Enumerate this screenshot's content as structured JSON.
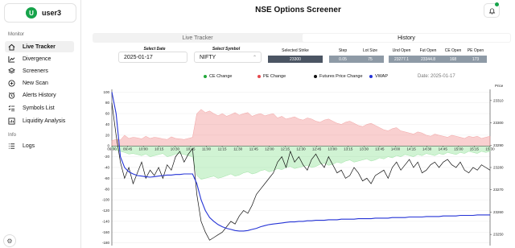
{
  "user": {
    "avatar_letter": "U",
    "name": "user3"
  },
  "sidebar": {
    "section_monitor": "Monitor",
    "section_info": "Info",
    "items": [
      {
        "label": "Live Tracker",
        "icon": "home-icon",
        "active": true
      },
      {
        "label": "Divergence",
        "icon": "trend-icon",
        "active": false
      },
      {
        "label": "Screeners",
        "icon": "layers-icon",
        "active": false
      },
      {
        "label": "New Scan",
        "icon": "plus-circle-icon",
        "active": false
      },
      {
        "label": "Alerts History",
        "icon": "alarm-icon",
        "active": false
      },
      {
        "label": "Symbols List",
        "icon": "list-check-icon",
        "active": false
      },
      {
        "label": "Liquidity Analysis",
        "icon": "chart-icon",
        "active": false
      }
    ],
    "info_items": [
      {
        "label": "Logs",
        "icon": "list-icon"
      }
    ]
  },
  "header": {
    "title": "NSE Options Screener"
  },
  "tabs": [
    {
      "label": "Live Tracker",
      "active": false
    },
    {
      "label": "History",
      "active": true
    }
  ],
  "filters": {
    "date_label": "Select Date",
    "date_value": "2025-01-17",
    "symbol_label": "Select Symbol",
    "symbol_value": "NIFTY"
  },
  "stats": {
    "selected_strike_label": "Selected Strike",
    "selected_strike_value": "23300",
    "step_label": "Step",
    "step_value": "0.05",
    "lot_size_label": "Lot Size",
    "lot_size_value": "75",
    "und_open_label": "Und Open",
    "und_open_value": "23277.1",
    "fut_open_label": "Fut Open",
    "fut_open_value": "23344.8",
    "ce_open_label": "CE Open",
    "ce_open_value": "168",
    "pe_open_label": "PE Open",
    "pe_open_value": "173"
  },
  "legend": {
    "items": [
      {
        "label": "CE Change",
        "color": "#22a83a"
      },
      {
        "label": "PE Change",
        "color": "#e5484d"
      },
      {
        "label": "Futures Price Change",
        "color": "#111111"
      },
      {
        "label": "VWAP",
        "color": "#2433d6"
      }
    ],
    "date_note": "Date: 2025-01-17"
  },
  "chart_data": {
    "type": "area",
    "x_ticks": [
      "09:30",
      "09:45",
      "10:00",
      "10:15",
      "10:30",
      "10:45",
      "11:00",
      "11:15",
      "11:30",
      "11:45",
      "12:00",
      "12:15",
      "12:30",
      "12:45",
      "13:00",
      "13:15",
      "13:30",
      "13:45",
      "14:00",
      "14:15",
      "14:30",
      "14:45",
      "15:00",
      "15:15",
      "15:30"
    ],
    "y_left_ticks": [
      100,
      80,
      60,
      40,
      20,
      0,
      -20,
      -40,
      -60,
      -80,
      -100,
      -120,
      -140,
      -160,
      -180
    ],
    "y_left_range": [
      -185,
      105
    ],
    "y_right_label": "Price",
    "y_right_ticks": [
      23310,
      23300,
      23290,
      23280,
      23270,
      23260,
      23250
    ],
    "y_right_range": [
      23245,
      23315
    ],
    "grid": true,
    "series": [
      {
        "name": "PE Change",
        "color": "#e5484d",
        "values": [
          10,
          12,
          11,
          20,
          14,
          16,
          15,
          13,
          18,
          14,
          16,
          15,
          13,
          12,
          17,
          14,
          13,
          12,
          14,
          16,
          60,
          68,
          62,
          65,
          60,
          56,
          60,
          55,
          58,
          62,
          57,
          60,
          62,
          55,
          58,
          60,
          56,
          58,
          60,
          52,
          55,
          50,
          52,
          54,
          50,
          48,
          52,
          50,
          46,
          44,
          48,
          50,
          46,
          42,
          40,
          44,
          46,
          42,
          38,
          36,
          40,
          42,
          38,
          34,
          30,
          28,
          32,
          34,
          28,
          26,
          24,
          22,
          26,
          24,
          20,
          18,
          22,
          20,
          18,
          16,
          20,
          18,
          16,
          14,
          18,
          16,
          18,
          14,
          16,
          18
        ]
      },
      {
        "name": "CE Change",
        "color": "#22a83a",
        "values": [
          -5,
          -8,
          -10,
          -12,
          -15,
          -14,
          -16,
          -18,
          -15,
          -20,
          -18,
          -16,
          -14,
          -20,
          -18,
          -15,
          -14,
          -16,
          -18,
          -20,
          -55,
          -62,
          -60,
          -58,
          -56,
          -60,
          -58,
          -55,
          -52,
          -56,
          -54,
          -50,
          -48,
          -52,
          -50,
          -46,
          -44,
          -48,
          -46,
          -42,
          -44,
          -40,
          -38,
          -42,
          -40,
          -38,
          -36,
          -40,
          -38,
          -34,
          -32,
          -36,
          -34,
          -30,
          -32,
          -28,
          -26,
          -30,
          -28,
          -26,
          -24,
          -28,
          -26,
          -22,
          -24,
          -20,
          -22,
          -18,
          -20,
          -16,
          -18,
          -20,
          -16,
          -18,
          -14,
          -16,
          -18,
          -14,
          -16,
          -12,
          -14,
          -16,
          -12,
          -14,
          -10,
          -12,
          -14,
          -10,
          -12,
          -10
        ]
      },
      {
        "name": "Futures Price Change",
        "color": "#111111",
        "values": [
          80,
          20,
          -30,
          -60,
          -40,
          -70,
          -50,
          -30,
          -60,
          -45,
          -55,
          -40,
          -60,
          -35,
          -45,
          -20,
          -10,
          -30,
          -15,
          -5,
          -90,
          -140,
          -160,
          -175,
          -170,
          -165,
          -160,
          -150,
          -140,
          -145,
          -130,
          -120,
          -125,
          -110,
          -90,
          -80,
          -70,
          -60,
          -50,
          -30,
          -20,
          -40,
          -10,
          -30,
          -20,
          -35,
          -45,
          -25,
          -15,
          -30,
          -40,
          -20,
          -35,
          -50,
          -45,
          -60,
          -55,
          -40,
          -50,
          -65,
          -60,
          -70,
          -55,
          -50,
          -45,
          -60,
          -40,
          -30,
          -45,
          -35,
          -25,
          -40,
          -30,
          -50,
          -45,
          -35,
          -30,
          -40,
          -30,
          -25,
          -35,
          -40,
          -30,
          -45,
          -50,
          -40,
          -45,
          -35,
          -40,
          -45
        ]
      },
      {
        "name": "VWAP",
        "color": "#2433d6",
        "values": [
          100,
          60,
          -20,
          -40,
          -48,
          -52,
          -55,
          -56,
          -57,
          -58,
          -57,
          -56,
          -55,
          -54,
          -54,
          -53,
          -53,
          -52,
          -52,
          -52,
          -70,
          -100,
          -120,
          -133,
          -140,
          -146,
          -150,
          -153,
          -155,
          -157,
          -158,
          -158,
          -157,
          -155,
          -153,
          -150,
          -148,
          -146,
          -145,
          -144,
          -143,
          -142,
          -141,
          -141,
          -140,
          -140,
          -139,
          -139,
          -138,
          -138,
          -138,
          -137,
          -137,
          -137,
          -136,
          -136,
          -136,
          -136,
          -135,
          -135,
          -135,
          -135,
          -134,
          -134,
          -134,
          -134,
          -133,
          -133,
          -133,
          -133,
          -132,
          -132,
          -132,
          -132,
          -131,
          -131,
          -131,
          -131,
          -130,
          -130,
          -130,
          -130,
          -129,
          -129,
          -129,
          -129,
          -128,
          -128,
          -128,
          -128
        ]
      }
    ]
  }
}
